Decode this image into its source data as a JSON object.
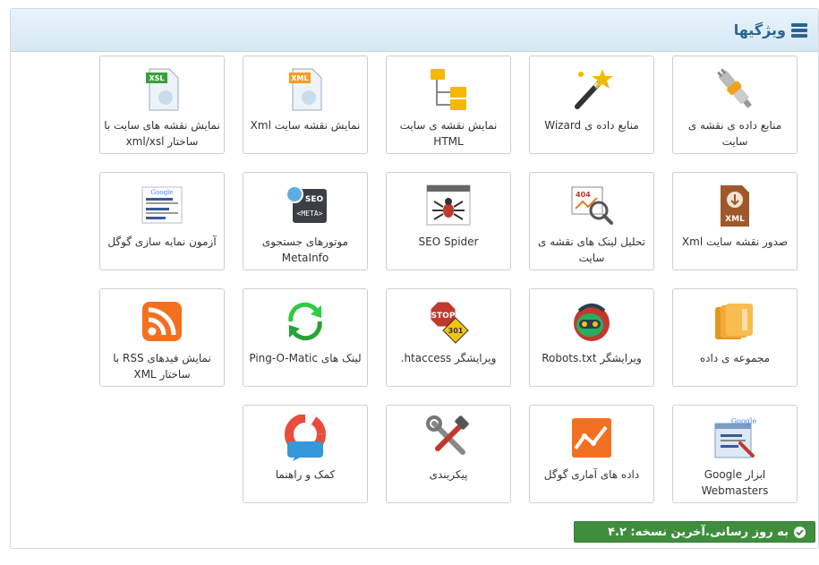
{
  "header": {
    "title": "ویژگیها",
    "icon": "database-icon"
  },
  "tiles": [
    {
      "label": "منابع داده ی نقشه ی سایت",
      "icon": "plug-icon"
    },
    {
      "label": "منابع داده ی Wizard",
      "icon": "magic-wand-icon"
    },
    {
      "label": "نمایش نقشه ی سایت HTML",
      "icon": "folder-tree-icon"
    },
    {
      "label": "نمایش نقشه سایت Xml",
      "icon": "xml-file-icon"
    },
    {
      "label": "نمایش نقشه های سایت با ساختار xml/xsl",
      "icon": "xsl-file-icon"
    },
    {
      "label": "صدور نقشه سایت Xml",
      "icon": "xml-download-icon"
    },
    {
      "label": "تحلیل لینک های نقشه ی سایت",
      "icon": "broken-link-icon"
    },
    {
      "label": "SEO Spider",
      "icon": "spider-icon"
    },
    {
      "label": "موتورهای جستجوی MetaInfo",
      "icon": "seo-meta-icon"
    },
    {
      "label": "آزمون نمایه سازی گوگل",
      "icon": "google-results-icon"
    },
    {
      "label": "مجموعه ی داده",
      "icon": "folder-stack-icon"
    },
    {
      "label": "ویرایشگر Robots.txt",
      "icon": "robot-icon"
    },
    {
      "label": "ویرایشگر htaccess.",
      "icon": "stop-sign-icon"
    },
    {
      "label": "لینک های Ping-O-Matic",
      "icon": "ping-arrows-icon"
    },
    {
      "label": "نمایش فیدهای RSS با ساختار XML",
      "icon": "rss-icon"
    },
    {
      "label": "ابزار Google Webmasters",
      "icon": "google-webmasters-icon"
    },
    {
      "label": "داده های آماری گوگل",
      "icon": "analytics-chart-icon"
    },
    {
      "label": "پیکربندی",
      "icon": "tools-icon"
    },
    {
      "label": "کمک و راهنما",
      "icon": "lifebuoy-icon"
    }
  ],
  "status": {
    "text": "به روز رسانی.آخرین نسخه: ۴.۲",
    "color": "#3e8e3e"
  }
}
